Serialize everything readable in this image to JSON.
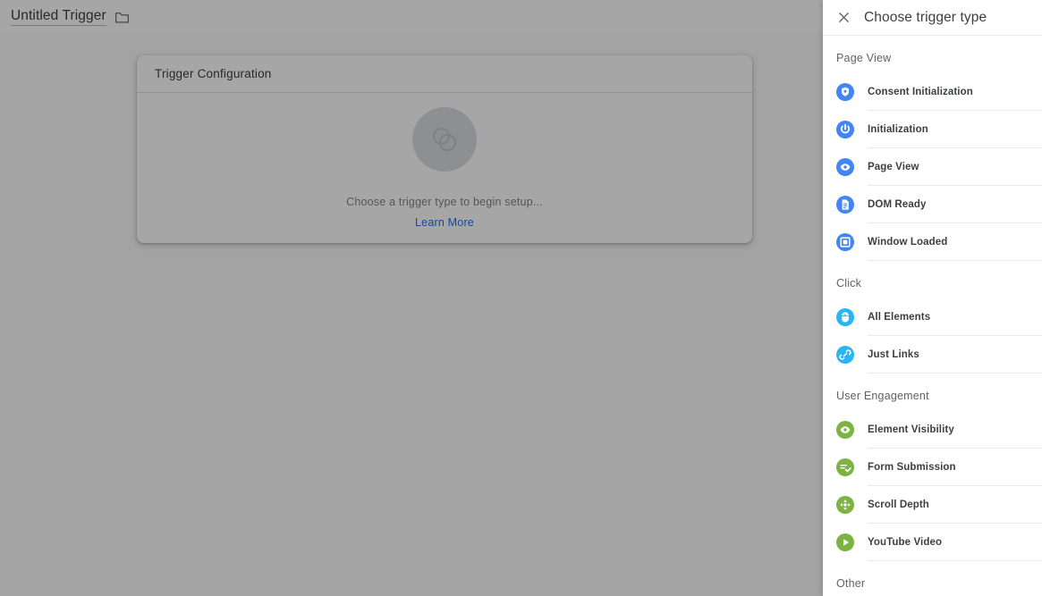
{
  "topbar": {
    "trigger_name": "Untitled Trigger",
    "folder_icon": "folder-icon"
  },
  "card": {
    "title": "Trigger Configuration",
    "placeholder_icon": "trigger-placeholder-icon",
    "empty_text": "Choose a trigger type to begin setup...",
    "learn_more": "Learn More",
    "learn_more_color": "#1a73e8"
  },
  "panel": {
    "close_icon": "close-icon",
    "title": "Choose trigger type",
    "groups": [
      {
        "name": "Page View",
        "color": "#4285F4",
        "items": [
          {
            "label": "Consent Initialization",
            "icon": "shield-icon"
          },
          {
            "label": "Initialization",
            "icon": "power-icon"
          },
          {
            "label": "Page View",
            "icon": "eye-icon"
          },
          {
            "label": "DOM Ready",
            "icon": "document-icon"
          },
          {
            "label": "Window Loaded",
            "icon": "window-icon"
          }
        ]
      },
      {
        "name": "Click",
        "color": "#29B6F6",
        "items": [
          {
            "label": "All Elements",
            "icon": "mouse-icon"
          },
          {
            "label": "Just Links",
            "icon": "link-icon"
          }
        ]
      },
      {
        "name": "User Engagement",
        "color": "#7CB342",
        "items": [
          {
            "label": "Element Visibility",
            "icon": "eye-icon"
          },
          {
            "label": "Form Submission",
            "icon": "form-check-icon"
          },
          {
            "label": "Scroll Depth",
            "icon": "move-arrows-icon"
          },
          {
            "label": "YouTube Video",
            "icon": "play-icon"
          }
        ]
      },
      {
        "name": "Other",
        "color": "#9E9E9E",
        "items": []
      }
    ]
  }
}
